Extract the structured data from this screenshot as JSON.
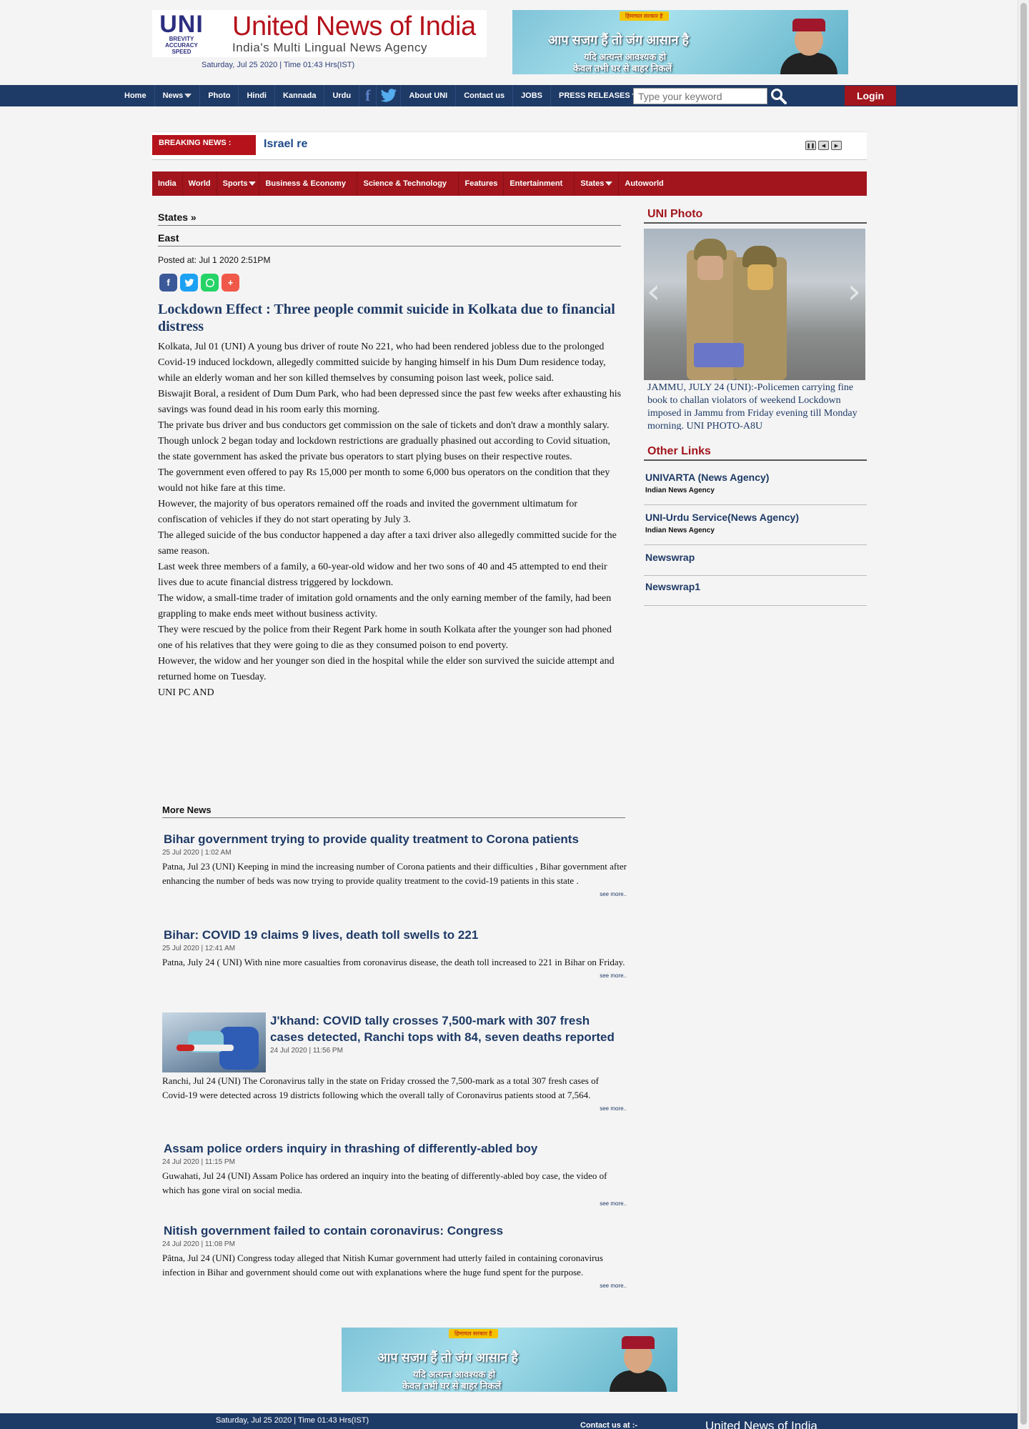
{
  "header": {
    "logo_uni": "UNI",
    "logo_tagline_lines": [
      "BREVITY",
      "ACCURACY",
      "SPEED"
    ],
    "site_name": "United News of India",
    "site_tagline": "India's Multi Lingual News Agency",
    "datetime": "Saturday, Jul 25 2020 | Time 01:43 Hrs(IST)"
  },
  "ad": {
    "badge": "हिमाचल सरकार है",
    "line1": "आप सजग हैं तो जंग आसान है",
    "line2": "यदि अत्यन्त आवश्यक हो",
    "line3": "केवल तभी घर से बाहर निकलें"
  },
  "nav": {
    "items": [
      "Home",
      "News",
      "Photo",
      "Hindi",
      "Kannada",
      "Urdu",
      "About UNI",
      "Contact us",
      "JOBS",
      "PRESS RELEASES"
    ],
    "search_placeholder": "Type your keyword",
    "login": "Login"
  },
  "breaking": {
    "label": "BREAKING NEWS :",
    "ticker": "Israel re"
  },
  "categories": [
    "India",
    "World",
    "Sports",
    "Business & Economy",
    "Science & Technology",
    "Features",
    "Entertainment",
    "States",
    "Autoworld"
  ],
  "article": {
    "breadcrumb": "States »",
    "region": "East",
    "posted": "Posted at: Jul 1 2020 2:51PM",
    "headline": "Lockdown Effect : Three people commit suicide in Kolkata due to financial distress",
    "paragraphs": [
      "Kolkata, Jul 01 (UNI) A young bus driver of route No 221, who had been rendered jobless due to the prolonged Covid-19 induced lockdown, allegedly committed suicide by hanging himself in his Dum Dum residence today, while an elderly woman and her son killed themselves by consuming poison last week, police said.",
      "Biswajit Boral, a resident of Dum Dum Park, who had been depressed since the past few weeks after exhausting his savings was found dead in his room early this morning.",
      "The private bus driver and bus conductors get commission on the sale of tickets and don't draw a monthly salary.",
      "Though unlock 2 began today and lockdown restrictions are gradually phasined out according to Covid situation, the state government has asked the private bus operators to start plying buses on their respective routes.",
      "The government even offered to pay Rs 15,000 per month to some 6,000 bus operators on the condition that they would not hike fare at this time.",
      "However, the majority of bus operators remained off the roads and invited the government ultimatum for confiscation of vehicles if they do not start operating by July 3.",
      "The alleged suicide of the bus conductor happened a day after a taxi driver also allegedly committed sucide for the same reason.",
      "Last week three members of a family, a 60-year-old widow and her two sons of 40 and 45 attempted to end their lives due to acute financial distress triggered by lockdown.",
      "The widow, a small-time trader of imitation gold ornaments and the only earning member of the family, had been grappling to make ends meet without business activity.",
      "They were rescued by the police from their Regent Park home in south Kolkata after the younger son had phoned one of his relatives that they were going to die as they consumed poison to end poverty.",
      "However, the widow and her younger son died in the hospital while the elder son survived the suicide attempt and returned home on Tuesday.",
      "UNI PC AND"
    ]
  },
  "more_news": {
    "title": "More News",
    "see_more": "see more..",
    "items": [
      {
        "title": "Bihar government trying to provide quality treatment to Corona patients",
        "date": "25 Jul 2020 | 1:02 AM",
        "summary": "Patna, Jul 23 (UNI) Keeping in mind the increasing number of Corona patients and their difficulties , Bihar government after enhancing the number of beds was now trying to provide quality treatment to the covid-19 patients in this state ."
      },
      {
        "title": "Bihar: COVID 19 claims 9 lives, death toll swells to 221",
        "date": "25 Jul 2020 | 12:41 AM",
        "summary": "Patna, July 24 ( UNI) With nine more casualties from coronavirus disease, the death toll increased to 221 in Bihar on Friday."
      },
      {
        "title": "J'khand: COVID tally crosses 7,500-mark with 307 fresh cases detected, Ranchi tops with 84, seven deaths reported",
        "date": "24 Jul 2020 | 11:56 PM",
        "summary": "Ranchi, Jul 24 (UNI) The Coronavirus tally in the state on Friday crossed the 7,500-mark as a total 307 fresh cases of Covid-19 were detected across 19 districts following which the overall tally of Coronavirus patients stood at 7,564."
      },
      {
        "title": "Assam police orders inquiry in thrashing of differently-abled boy",
        "date": "24 Jul 2020 | 11:15 PM",
        "summary": "Guwahati, Jul 24 (UNI) Assam Police has ordered an inquiry into the beating of differently-abled boy case, the video of which has gone viral on social media."
      },
      {
        "title": "Nitish government failed to contain coronavirus: Congress",
        "date": "24 Jul 2020 | 11:08 PM",
        "summary": "Pâtna, Jul 24 (UNI) Congress today alleged that Nitish Kumar government had utterly failed in containing coronavirus infection in Bihar and government should come out with explanations where the huge fund spent for the purpose."
      }
    ]
  },
  "sidebar": {
    "photo_title": "UNI Photo",
    "photo_caption": "JAMMU, JULY 24 (UNI):-Policemen carrying fine book to challan violators of weekend Lockdown imposed in Jammu from Friday evening till Monday morning. UNI PHOTO-A8U",
    "other_links_title": "Other Links",
    "links": [
      {
        "name": "UNIVARTA (News Agency)",
        "sub": "Indian News Agency"
      },
      {
        "name": "UNI-Urdu Service(News Agency)",
        "sub": "Indian News Agency"
      },
      {
        "name": "Newswrap",
        "sub": ""
      },
      {
        "name": "Newswrap1",
        "sub": ""
      }
    ]
  },
  "footer": {
    "datetime": "Saturday, Jul 25 2020 | Time 01:43 Hrs(IST)",
    "contact": "Contact us at :-",
    "name": "United News of India"
  }
}
